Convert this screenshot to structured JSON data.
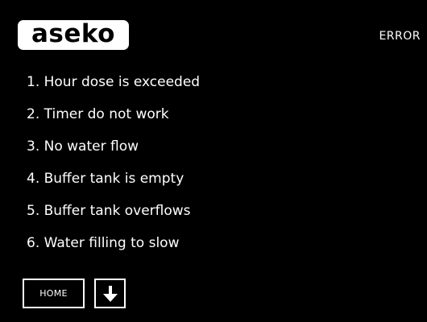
{
  "header": {
    "logo_text": "aseko",
    "title": "ERROR"
  },
  "errors": [
    "1. Hour dose is exceeded",
    "2. Timer do not work",
    "3. No water flow",
    "4. Buffer tank is empty",
    "5. Buffer tank overflows",
    "6. Water filling to slow"
  ],
  "footer": {
    "home_label": "HOME",
    "down_icon": "arrow-down-icon"
  },
  "colors": {
    "background": "#000000",
    "foreground": "#ffffff"
  }
}
